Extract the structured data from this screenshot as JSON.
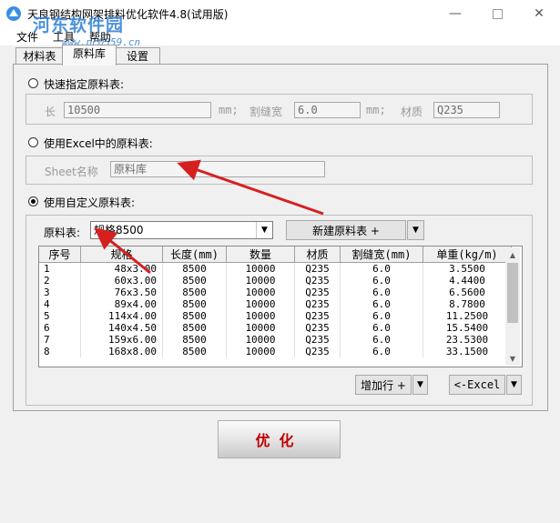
{
  "window": {
    "title": "天良钢结构网架排料优化软件4.8(试用版)",
    "watermark": "河东软件园",
    "watermark_url": "www.pc0359.cn"
  },
  "menu": [
    "文件",
    "工具",
    "帮助"
  ],
  "tabs": [
    "材料表",
    "原料库",
    "设置"
  ],
  "active_tab": 1,
  "options": {
    "quick": {
      "label": "快速指定原料表:",
      "selected": false,
      "length_label": "长",
      "length_value": "10500",
      "length_unit": "mm;",
      "kerf_label": "割缝宽",
      "kerf_value": "6.0",
      "kerf_unit": "mm;",
      "material_label": "材质",
      "material_value": "Q235"
    },
    "excel": {
      "label": "使用Excel中的原料表:",
      "selected": false,
      "sheet_label": "Sheet名称",
      "sheet_value": "原料库"
    },
    "custom": {
      "label": "使用自定义原料表:",
      "selected": true,
      "material_table_label": "原料表:",
      "material_table_value": "规格8500",
      "new_table_button": "新建原料表 +"
    }
  },
  "table": {
    "columns": [
      "序号",
      "规格",
      "长度(mm)",
      "数量",
      "材质",
      "割缝宽(mm)",
      "单重(kg/m)"
    ],
    "rows": [
      [
        "1",
        "48x3.00",
        "8500",
        "10000",
        "Q235",
        "6.0",
        "3.5500"
      ],
      [
        "2",
        "60x3.00",
        "8500",
        "10000",
        "Q235",
        "6.0",
        "4.4400"
      ],
      [
        "3",
        "76x3.50",
        "8500",
        "10000",
        "Q235",
        "6.0",
        "6.5600"
      ],
      [
        "4",
        "89x4.00",
        "8500",
        "10000",
        "Q235",
        "6.0",
        "8.7800"
      ],
      [
        "5",
        "114x4.00",
        "8500",
        "10000",
        "Q235",
        "6.0",
        "11.2500"
      ],
      [
        "6",
        "140x4.50",
        "8500",
        "10000",
        "Q235",
        "6.0",
        "15.5400"
      ],
      [
        "7",
        "159x6.00",
        "8500",
        "10000",
        "Q235",
        "6.0",
        "23.5300"
      ],
      [
        "8",
        "168x8.00",
        "8500",
        "10000",
        "Q235",
        "6.0",
        "33.1500"
      ]
    ]
  },
  "buttons": {
    "add_row": "增加行 +",
    "excel_import": "<-Excel",
    "optimize": "优化"
  },
  "colors": {
    "annotation_arrow": "#d62020",
    "optimize_text": "#c00000",
    "watermark": "#2f7fd6"
  }
}
